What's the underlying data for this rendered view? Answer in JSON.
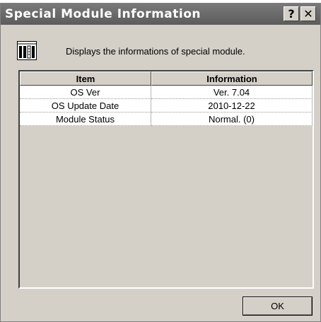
{
  "window": {
    "title": "Special Module Information"
  },
  "titlebar_buttons": {
    "help": "?",
    "close": "✕"
  },
  "header": {
    "description": "Displays the informations of special module."
  },
  "table": {
    "columns": [
      "Item",
      "Information"
    ],
    "rows": [
      [
        "OS Ver",
        "Ver.  7.04"
      ],
      [
        "OS Update Date",
        "2010-12-22"
      ],
      [
        "Module Status",
        "Normal. (0)"
      ]
    ]
  },
  "buttons": {
    "ok": "OK"
  }
}
